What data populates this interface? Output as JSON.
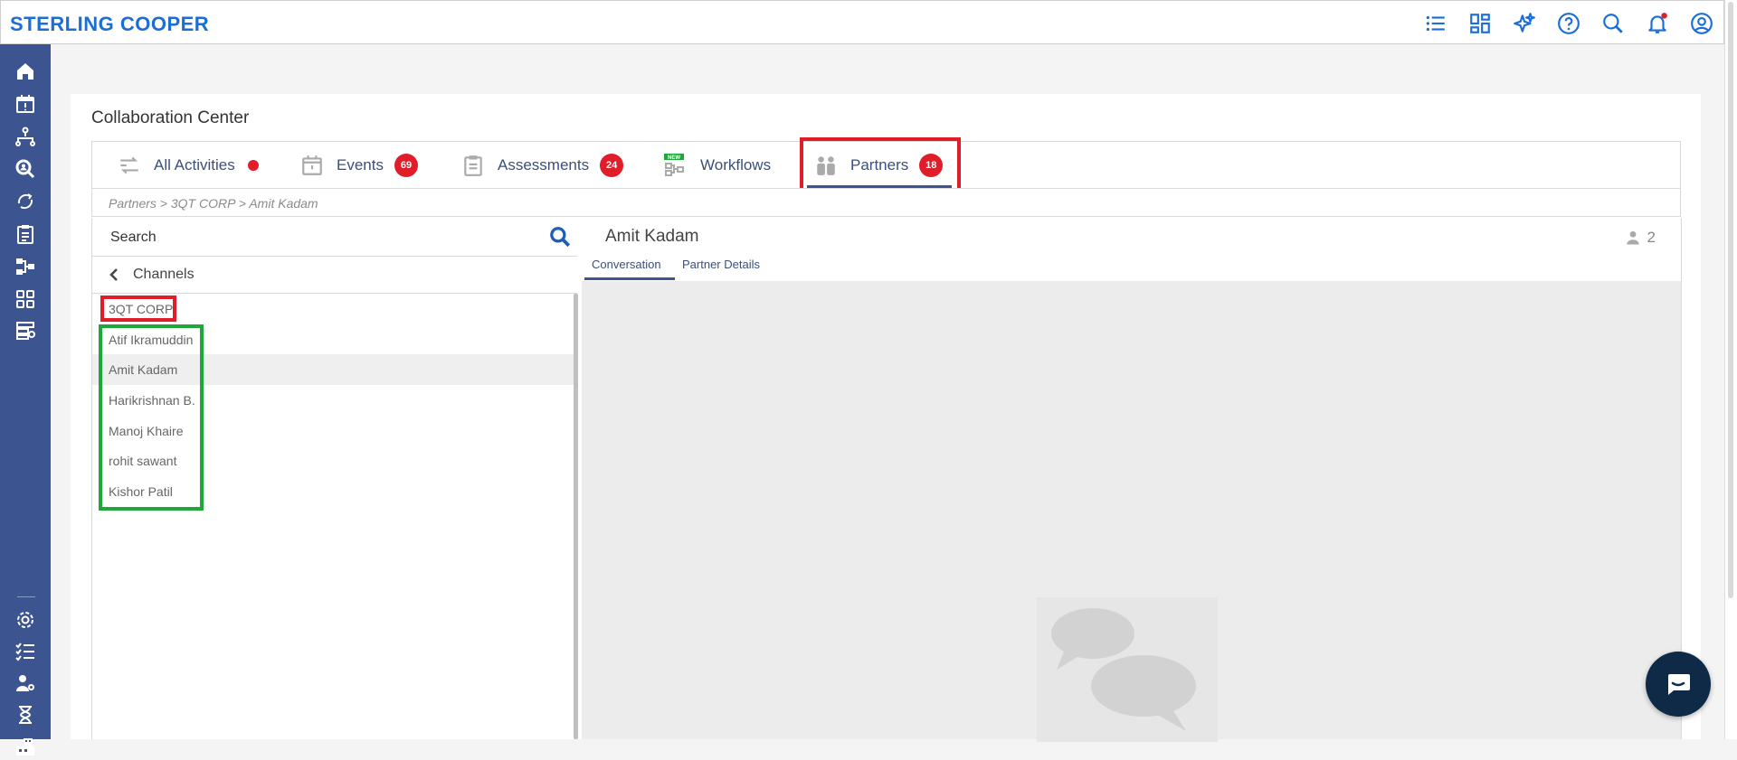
{
  "app": {
    "logo": "STERLING COOPER"
  },
  "topbar": {
    "icons": [
      "list-icon",
      "dashboard-icon",
      "sparkle-icon",
      "help-icon",
      "search-icon",
      "bell-icon",
      "user-circle-icon"
    ]
  },
  "sidebar": {
    "icons": [
      "home-icon",
      "calendar-icon",
      "hierarchy-icon",
      "search-user-icon",
      "cycle-icon",
      "clipboard-icon",
      "workflow-icon",
      "apps-icon",
      "settings-stack-icon",
      "gear-icon",
      "checklist-icon",
      "user-settings-icon",
      "hourglass-icon",
      "building-icon"
    ]
  },
  "page": {
    "title": "Collaboration Center"
  },
  "tabs": [
    {
      "label": "All Activities",
      "indicator": "dot"
    },
    {
      "label": "Events",
      "badge": "69"
    },
    {
      "label": "Assessments",
      "badge": "24"
    },
    {
      "label": "Workflows",
      "tag": "NEW"
    },
    {
      "label": "Partners",
      "badge": "18",
      "active": true
    }
  ],
  "breadcrumb": "Partners > 3QT CORP > Amit Kadam",
  "left": {
    "search_placeholder": "Search",
    "channels_label": "Channels",
    "company": "3QT CORP",
    "members": [
      "Atif Ikramuddin",
      "Amit Kadam",
      "Harikrishnan B.",
      "Manoj Khaire",
      "rohit sawant",
      "Kishor Patil"
    ],
    "selected_member": "Amit Kadam"
  },
  "right": {
    "name": "Amit Kadam",
    "participant_count": "2",
    "tabs": [
      "Conversation",
      "Partner Details"
    ],
    "active_tab": "Conversation"
  },
  "colors": {
    "brand": "#1b6ed6",
    "sidebar": "#3c5591",
    "badge": "#e11d2a",
    "highlight_red": "#e11d2a",
    "highlight_green": "#1fa83a"
  }
}
